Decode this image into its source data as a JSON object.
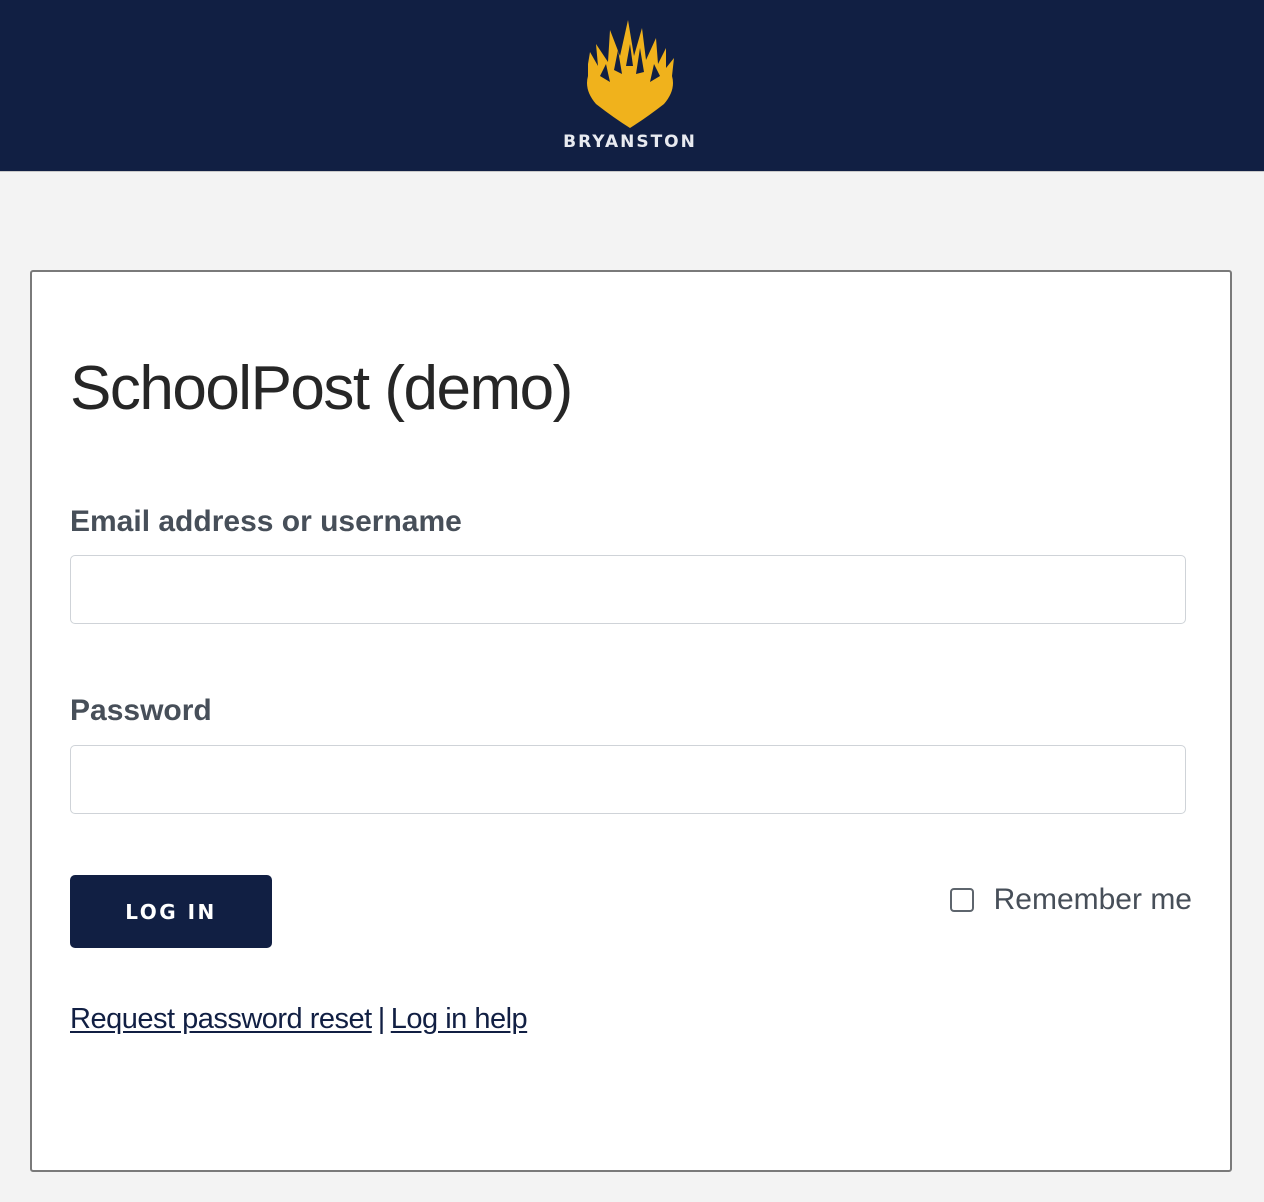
{
  "header": {
    "brand_name": "BRYANSTON",
    "logo_icon": "flame-shield-icon",
    "bg_color": "#111f43",
    "logo_color": "#f0b21c"
  },
  "login": {
    "title": "SchoolPost (demo)",
    "email_label": "Email address or username",
    "email_value": "",
    "password_label": "Password",
    "password_value": "",
    "login_button": "LOG IN",
    "remember_label": "Remember me",
    "remember_checked": false,
    "reset_link": "Request password reset",
    "separator": "|",
    "help_link": "Log in help"
  }
}
